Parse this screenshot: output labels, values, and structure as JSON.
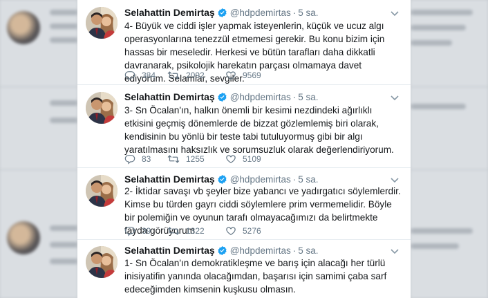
{
  "colors": {
    "verified": "#1da1f2",
    "secondary_text": "#657786",
    "primary_text": "#14171a",
    "divider": "#e6ecf0"
  },
  "icons": {
    "reply": "reply-icon",
    "retweet": "retweet-icon",
    "like": "heart-icon",
    "verified": "verified-badge-icon",
    "more": "chevron-down-icon"
  },
  "tweets": [
    {
      "name": "Selahattin Demirtaş",
      "handle": "@hdpdemirtas",
      "separator": "·",
      "time": "5 sa.",
      "text": "4- Büyük ve ciddi işler yapmak isteyenlerin, küçük ve ucuz algı operasyonlarına tenezzül etmemesi gerekir. Bu konu bizim için hassas bir meseledir. Herkesi ve bütün tarafları daha dikkatli davranarak, psikolojik harekatın parçası olmamaya davet ediyorum. Selamlar, sevgiler.",
      "replies": "384",
      "retweets": "2092",
      "likes": "9569"
    },
    {
      "name": "Selahattin Demirtaş",
      "handle": "@hdpdemirtas",
      "separator": "·",
      "time": "5 sa.",
      "text": "3- Sn Öcalan'ın, halkın önemli bir kesimi nezdindeki ağırlıklı etkisini geçmiş dönemlerde de bizzat gözlemlemiş biri olarak, kendisinin bu yönlü bir teste tabi tutuluyormuş gibi bir algı yaratılmasını haksızlık ve sorumsuzluk olarak değerlendiriyorum.",
      "replies": "83",
      "retweets": "1255",
      "likes": "5109"
    },
    {
      "name": "Selahattin Demirtaş",
      "handle": "@hdpdemirtas",
      "separator": "·",
      "time": "5 sa.",
      "text": "2- İktidar savaşı vb şeyler bize yabancı ve yadırgatıcı söylemlerdir. Kimse bu türden gayrı ciddi söylemlere prim vermemelidir. Böyle bir polemiğin ve oyunun tarafı olmayacağımızı da belirtmekte fayda görüyorum.",
      "replies": "39",
      "retweets": "1322",
      "likes": "5276"
    },
    {
      "name": "Selahattin Demirtaş",
      "handle": "@hdpdemirtas",
      "separator": "·",
      "time": "5 sa.",
      "text": "1- Sn Öcalan'ın demokratikleşme ve barış için alacağı her türlü inisiyatifin yanında olacağımdan, başarısı için samimi çaba sarf edeceğimden kimsenin kuşkusu olmasın."
    }
  ]
}
